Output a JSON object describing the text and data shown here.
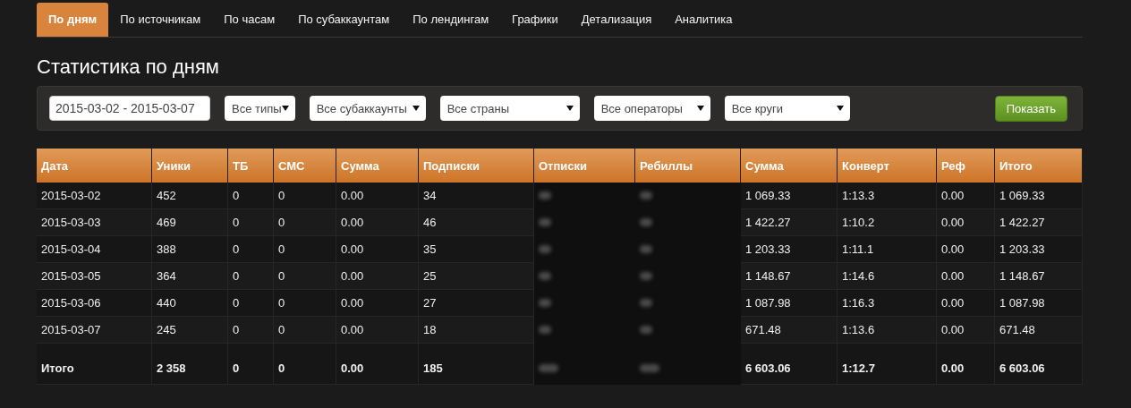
{
  "tabs": [
    {
      "label": "По дням",
      "selected": true
    },
    {
      "label": "По источникам",
      "selected": false
    },
    {
      "label": "По часам",
      "selected": false
    },
    {
      "label": "По субаккаунтам",
      "selected": false
    },
    {
      "label": "По лендингам",
      "selected": false
    },
    {
      "label": "Графики",
      "selected": false
    },
    {
      "label": "Детализация",
      "selected": false
    },
    {
      "label": "Аналитика",
      "selected": false
    }
  ],
  "title": "Статистика по дням",
  "filters": {
    "date_range": {
      "value": "2015-03-02 - 2015-03-07"
    },
    "selects": [
      {
        "value": "Все типы"
      },
      {
        "value": "Все субаккаунты"
      },
      {
        "value": "Все страны"
      },
      {
        "value": "Все операторы"
      },
      {
        "value": "Все круги"
      }
    ],
    "button": "Показать"
  },
  "table": {
    "columns": [
      "Дата",
      "Уники",
      "ТБ",
      "СМС",
      "Сумма",
      "Подписки",
      "Отписки",
      "Ребиллы",
      "Сумма",
      "Конверт",
      "Реф",
      "Итого"
    ],
    "rows": [
      {
        "kind": "day",
        "cells": [
          "2015-03-02",
          "452",
          "0",
          "0",
          "0.00",
          "34",
          "",
          "",
          "1 069.33",
          "1:13.3",
          "0.00",
          "1 069.33"
        ]
      },
      {
        "kind": "day",
        "cells": [
          "2015-03-03",
          "469",
          "0",
          "0",
          "0.00",
          "46",
          "",
          "",
          "1 422.27",
          "1:10.2",
          "0.00",
          "1 422.27"
        ]
      },
      {
        "kind": "day",
        "cells": [
          "2015-03-04",
          "388",
          "0",
          "0",
          "0.00",
          "35",
          "",
          "",
          "1 203.33",
          "1:11.1",
          "0.00",
          "1 203.33"
        ]
      },
      {
        "kind": "day",
        "cells": [
          "2015-03-05",
          "364",
          "0",
          "0",
          "0.00",
          "25",
          "",
          "",
          "1 148.67",
          "1:14.6",
          "0.00",
          "1 148.67"
        ]
      },
      {
        "kind": "day",
        "cells": [
          "2015-03-06",
          "440",
          "0",
          "0",
          "0.00",
          "27",
          "",
          "",
          "1 087.98",
          "1:16.3",
          "0.00",
          "1 087.98"
        ]
      },
      {
        "kind": "day",
        "cells": [
          "2015-03-07",
          "245",
          "0",
          "0",
          "0.00",
          "18",
          "",
          "",
          "671.48",
          "1:13.6",
          "0.00",
          "671.48"
        ]
      },
      {
        "kind": "total",
        "cells": [
          "Итого",
          "2 358",
          "0",
          "0",
          "0.00",
          "185",
          "",
          "",
          "6 603.06",
          "1:12.7",
          "0.00",
          "6 603.06"
        ]
      }
    ]
  }
}
